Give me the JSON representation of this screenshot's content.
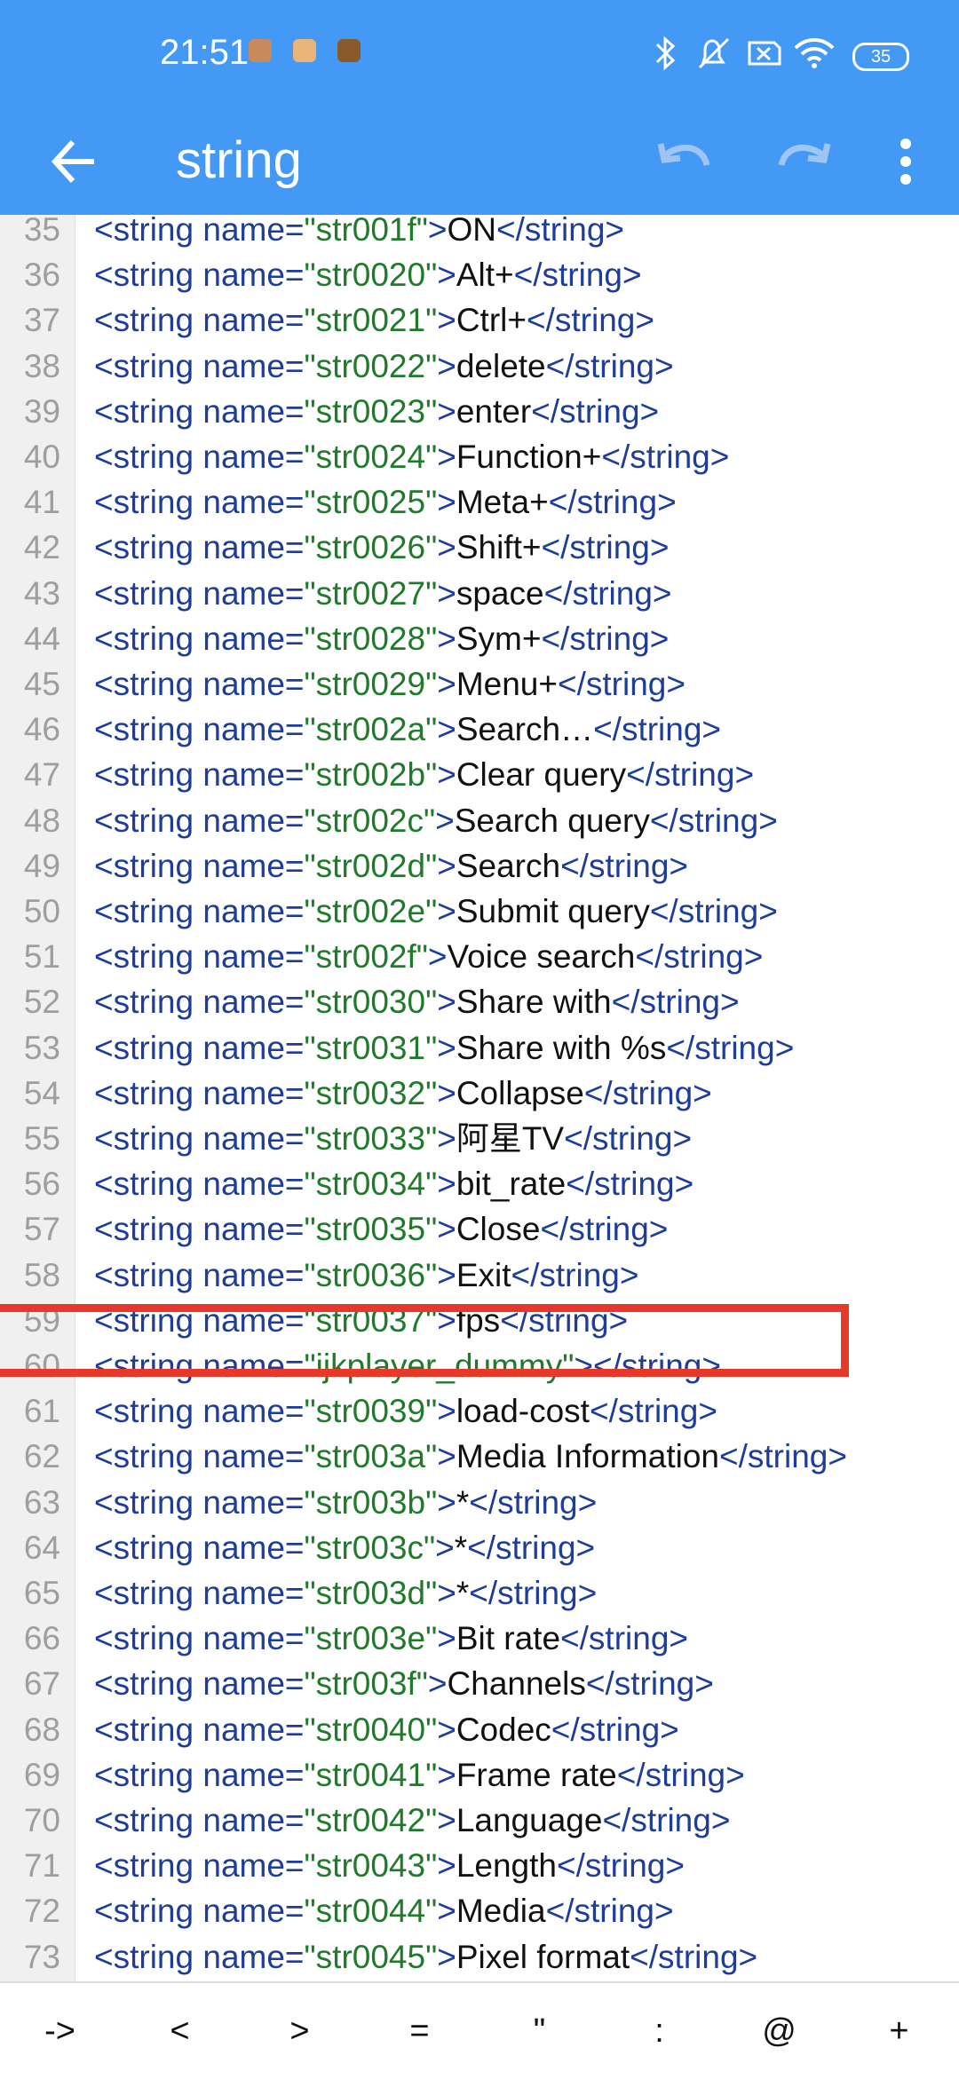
{
  "status_bar": {
    "time": "21:51",
    "battery": "35",
    "icons": [
      "bluetooth-icon",
      "mute-icon",
      "no-sim-icon",
      "wifi-icon",
      "battery-icon"
    ],
    "notification_icons": [
      "app-notif-1",
      "app-notif-2",
      "app-notif-3"
    ]
  },
  "appbar": {
    "title": "string",
    "back_icon": "arrow-left-icon",
    "actions": [
      "undo-icon",
      "redo-icon",
      "more-vert-icon"
    ]
  },
  "editor": {
    "lines": [
      {
        "n": "35",
        "name": "str001f",
        "value": "ON"
      },
      {
        "n": "36",
        "name": "str0020",
        "value": "Alt+"
      },
      {
        "n": "37",
        "name": "str0021",
        "value": "Ctrl+"
      },
      {
        "n": "38",
        "name": "str0022",
        "value": "delete"
      },
      {
        "n": "39",
        "name": "str0023",
        "value": "enter"
      },
      {
        "n": "40",
        "name": "str0024",
        "value": "Function+"
      },
      {
        "n": "41",
        "name": "str0025",
        "value": "Meta+"
      },
      {
        "n": "42",
        "name": "str0026",
        "value": "Shift+"
      },
      {
        "n": "43",
        "name": "str0027",
        "value": "space"
      },
      {
        "n": "44",
        "name": "str0028",
        "value": "Sym+"
      },
      {
        "n": "45",
        "name": "str0029",
        "value": "Menu+"
      },
      {
        "n": "46",
        "name": "str002a",
        "value": "Search…"
      },
      {
        "n": "47",
        "name": "str002b",
        "value": "Clear query"
      },
      {
        "n": "48",
        "name": "str002c",
        "value": "Search query"
      },
      {
        "n": "49",
        "name": "str002d",
        "value": "Search"
      },
      {
        "n": "50",
        "name": "str002e",
        "value": "Submit query"
      },
      {
        "n": "51",
        "name": "str002f",
        "value": "Voice search"
      },
      {
        "n": "52",
        "name": "str0030",
        "value": "Share with"
      },
      {
        "n": "53",
        "name": "str0031",
        "value": "Share with %s"
      },
      {
        "n": "54",
        "name": "str0032",
        "value": "Collapse"
      },
      {
        "n": "55",
        "name": "str0033",
        "value": "阿星TV"
      },
      {
        "n": "56",
        "name": "str0034",
        "value": "bit_rate"
      },
      {
        "n": "57",
        "name": "str0035",
        "value": "Close"
      },
      {
        "n": "58",
        "name": "str0036",
        "value": "Exit"
      },
      {
        "n": "59",
        "name": "str0037",
        "value": "fps"
      },
      {
        "n": "60",
        "name": "ijkplayer_dummy",
        "value": ""
      },
      {
        "n": "61",
        "name": "str0039",
        "value": "load-cost"
      },
      {
        "n": "62",
        "name": "str003a",
        "value": "Media Information"
      },
      {
        "n": "63",
        "name": "str003b",
        "value": "*"
      },
      {
        "n": "64",
        "name": "str003c",
        "value": "*"
      },
      {
        "n": "65",
        "name": "str003d",
        "value": "*"
      },
      {
        "n": "66",
        "name": "str003e",
        "value": "Bit rate"
      },
      {
        "n": "67",
        "name": "str003f",
        "value": "Channels"
      },
      {
        "n": "68",
        "name": "str0040",
        "value": "Codec"
      },
      {
        "n": "69",
        "name": "str0041",
        "value": "Frame rate"
      },
      {
        "n": "70",
        "name": "str0042",
        "value": "Language"
      },
      {
        "n": "71",
        "name": "str0043",
        "value": "Length"
      },
      {
        "n": "72",
        "name": "str0044",
        "value": "Media"
      },
      {
        "n": "73",
        "name": "str0045",
        "value": "Pixel format"
      }
    ],
    "highlighted_line": "55"
  },
  "symbol_bar": {
    "keys": [
      "->",
      "<",
      ">",
      "=",
      "\"",
      ":",
      "@",
      "+"
    ]
  },
  "colors": {
    "appbar": "#4499f5",
    "tag": "#1e3d99",
    "attr_value": "#1f7a2a",
    "highlight": "#e8382a"
  }
}
